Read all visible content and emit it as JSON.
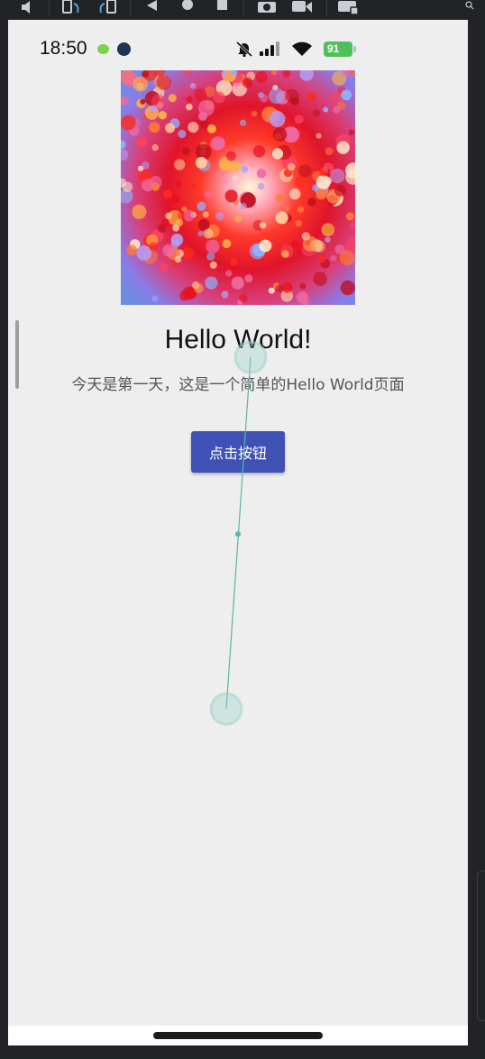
{
  "status_bar": {
    "time": "18:50",
    "battery": "91"
  },
  "main": {
    "title": "Hello World!",
    "subtitle": "今天是第一天，这是一个简单的Hello World页面",
    "button_label": "点击按钮"
  },
  "icons": {
    "toolbar": [
      "volume-icon",
      "rotate-left-icon",
      "rotate-right-icon",
      "back-icon",
      "home-icon",
      "overview-icon",
      "screenshot-icon",
      "record-icon",
      "keyboard-icon"
    ],
    "status": [
      "wechat-icon",
      "app-icon",
      "bell-off-icon",
      "signal-icon",
      "wifi-icon",
      "battery-icon"
    ]
  },
  "colors": {
    "screen_bg": "#eeeeee",
    "button_bg": "#3f51b5",
    "emulator_frame": "#212327",
    "touch_trace": "#5bb5aa",
    "battery": "#52c05a"
  }
}
